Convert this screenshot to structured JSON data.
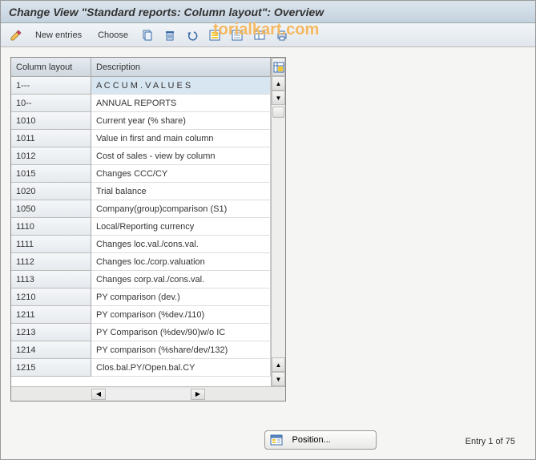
{
  "watermark": "torialkart.com",
  "title": "Change View \"Standard reports: Column layout\": Overview",
  "toolbar": {
    "new_entries": "New entries",
    "choose": "Choose"
  },
  "table": {
    "headers": {
      "col_layout": "Column layout",
      "col_desc": "Description"
    },
    "rows": [
      {
        "layout": "1---",
        "desc": "A C C U M .   V A L U E S",
        "selected": true
      },
      {
        "layout": "10--",
        "desc": "ANNUAL REPORTS"
      },
      {
        "layout": "1010",
        "desc": "Current year (% share)"
      },
      {
        "layout": "1011",
        "desc": "Value in first and main column"
      },
      {
        "layout": "1012",
        "desc": "Cost of sales - view by column"
      },
      {
        "layout": "1015",
        "desc": "Changes CCC/CY"
      },
      {
        "layout": "1020",
        "desc": "Trial balance"
      },
      {
        "layout": "1050",
        "desc": "Company(group)comparison  (S1)"
      },
      {
        "layout": "1110",
        "desc": "Local/Reporting currency"
      },
      {
        "layout": "1111",
        "desc": "Changes loc.val./cons.val."
      },
      {
        "layout": "1112",
        "desc": "Changes loc./corp.valuation"
      },
      {
        "layout": "1113",
        "desc": "Changes corp.val./cons.val."
      },
      {
        "layout": "1210",
        "desc": "PY comparison (dev.)"
      },
      {
        "layout": "1211",
        "desc": "PY comparison (%dev./110)"
      },
      {
        "layout": "1213",
        "desc": "PY Comparison (%dev/90)w/o IC"
      },
      {
        "layout": "1214",
        "desc": "PY comparison (%share/dev/132)"
      },
      {
        "layout": "1215",
        "desc": "Clos.bal.PY/Open.bal.CY"
      }
    ]
  },
  "footer": {
    "position_label": "Position...",
    "entry_text": "Entry 1 of 75"
  }
}
